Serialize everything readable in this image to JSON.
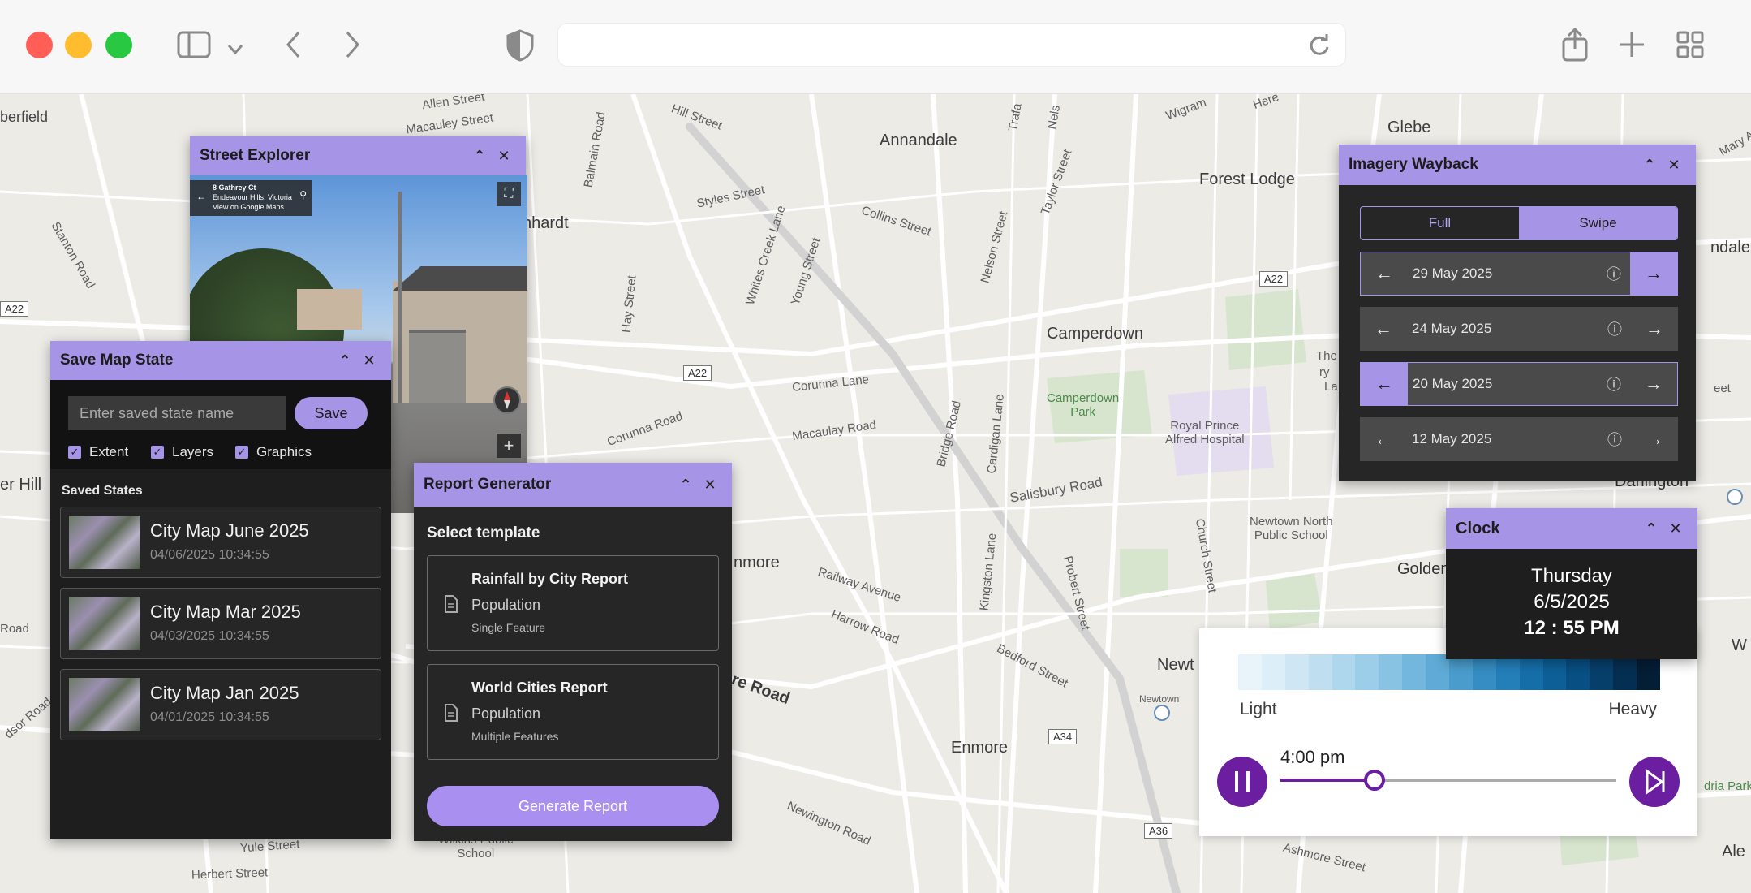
{
  "browser": {
    "traffic_lights": [
      "#ff5f57",
      "#febc2e",
      "#28c840"
    ]
  },
  "map": {
    "labels": {
      "berfield": "berfield",
      "allen": "Allen Street",
      "macauley": "Macauley Street",
      "hill_street": "Hill Street",
      "balmain": "Balmain Road",
      "annandale": "Annandale",
      "glebe": "Glebe",
      "forest_lodge": "Forest Lodge",
      "wigram": "Wigram",
      "collins": "Collins Street",
      "styles": "Styles Street",
      "nelson": "Nelson Street",
      "taylor": "Taylor Street",
      "whites": "Whites Creek Lane",
      "young": "Young Street",
      "hay": "Hay Street",
      "stanton": "Stanton Road",
      "camperdown": "Camperdown",
      "camperdown_park": "Camperdown\nPark",
      "royal": "Royal Prince\nAlfred Hospital",
      "corunna_lane": "Corunna Lane",
      "corunna_road": "Corunna Road",
      "macaulay_road": "Macaulay Road",
      "bridge": "Bridge Road",
      "cardigan": "Cardigan Lane",
      "salisbury": "Salisbury Road",
      "newtown_north": "Newtown North\nPublic School",
      "church": "Church Street",
      "railway": "Railway Avenue",
      "harrow": "Harrow Road",
      "kingston": "Kingston Lane",
      "probert": "Probert Street",
      "bedford": "Bedford Street",
      "enmore": "Enmore",
      "newt": "Newt",
      "newtown_stn": "Newtown",
      "newington": "Newington Road",
      "wilkins": "Wilkins Public\nSchool",
      "yule": "Yule Street",
      "herbert": "Herbert Street",
      "ashmore": "Ashmore Street",
      "golden": "Golden",
      "darlington": "Darlington",
      "ndale": "ndale",
      "ahhardt": "hhardt",
      "nmore": "nmore",
      "re_road": "re Road",
      "er_hill": "er Hill",
      "road_left": "Road",
      "dsor": "dsor Road",
      "ale": "Ale",
      "w": "W",
      "dria": "dria Park",
      "eet": "eet",
      "the": "The",
      "ry": "ry",
      "la": "La",
      "mary": "Mary Ann",
      "here": "Here",
      "nelson2": "Nels",
      "tra": "Trafa"
    },
    "shields": {
      "a22_left": "A22",
      "a22_mid": "A22",
      "a22_right": "A22",
      "a34": "A34",
      "a36": "A36"
    }
  },
  "street_explorer": {
    "title": "Street Explorer",
    "card_line1": "8 Gathrey Ct",
    "card_line2": "Endeavour Hills, Victoria",
    "card_line3": "View on Google Maps"
  },
  "save_map_state": {
    "title": "Save Map State",
    "input_placeholder": "Enter saved state name",
    "save_label": "Save",
    "options": [
      "Extent",
      "Layers",
      "Graphics"
    ],
    "saved_title": "Saved States",
    "states": [
      {
        "name": "City Map June 2025",
        "date": "04/06/2025  10:34:55"
      },
      {
        "name": "City Map Mar 2025",
        "date": "04/03/2025  10:34:55"
      },
      {
        "name": "City Map Jan 2025",
        "date": "04/01/2025  10:34:55"
      }
    ]
  },
  "report_generator": {
    "title": "Report Generator",
    "select_label": "Select template",
    "templates": [
      {
        "title": "Rainfall by City Report",
        "subtitle": "Population",
        "meta": "Single Feature"
      },
      {
        "title": "World Cities Report",
        "subtitle": "Population",
        "meta": "Multiple Features"
      }
    ],
    "generate_label": "Generate Report"
  },
  "imagery_wayback": {
    "title": "Imagery Wayback",
    "modes": [
      "Full",
      "Swipe"
    ],
    "active_mode": "Swipe",
    "dates": [
      "29 May 2025",
      "24 May 2025",
      "20 May 2025",
      "12 May 2025"
    ]
  },
  "clock": {
    "title": "Clock",
    "day": "Thursday",
    "date": "6/5/2025",
    "time": "12 : 55 PM"
  },
  "rainfall": {
    "low_label": "Light",
    "high_label": "Heavy",
    "ramp_colors": [
      "#e9f3fa",
      "#dceef8",
      "#cfe7f4",
      "#bfdff0",
      "#aed6ec",
      "#9cceea",
      "#88c3e4",
      "#74b7de",
      "#5faad6",
      "#4a9ccd",
      "#368dc3",
      "#247eb8",
      "#166ea9",
      "#0d5f97",
      "#084f83",
      "#073f6b",
      "#052f52",
      "#041e36"
    ],
    "time_label": "4:00 pm",
    "slider_fraction": 0.28
  },
  "colors": {
    "accent": "#a695e6",
    "panel": "#262626",
    "play": "#6b1fa0"
  }
}
